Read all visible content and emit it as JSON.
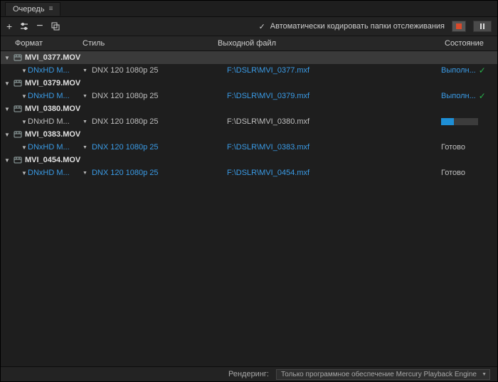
{
  "window": {
    "title": "Очередь"
  },
  "toolbar": {
    "add": "+",
    "auto_encode_label": "Автоматически кодировать папки отслеживания"
  },
  "columns": {
    "format": "Формат",
    "style": "Стиль",
    "output": "Выходной файл",
    "state": "Состояние"
  },
  "groups": [
    {
      "name": "MVI_0377.MOV",
      "selected": true,
      "job": {
        "format": "DNxHD M...",
        "style": "DNX 120 1080p 25",
        "output": "F:\\DSLR\\MVI_0377.mxf",
        "state_text": "Выполн...",
        "state_kind": "done",
        "link": true,
        "style_link": false
      }
    },
    {
      "name": "MVI_0379.MOV",
      "selected": false,
      "job": {
        "format": "DNxHD M...",
        "style": "DNX 120 1080p 25",
        "output": "F:\\DSLR\\MVI_0379.mxf",
        "state_text": "Выполн...",
        "state_kind": "done",
        "link": true,
        "style_link": false
      }
    },
    {
      "name": "MVI_0380.MOV",
      "selected": false,
      "job": {
        "format": "DNxHD M...",
        "style": "DNX 120 1080p 25",
        "output": "F:\\DSLR\\MVI_0380.mxf",
        "state_text": "",
        "state_kind": "progress",
        "progress": 35,
        "link": false,
        "style_link": false
      }
    },
    {
      "name": "MVI_0383.MOV",
      "selected": false,
      "job": {
        "format": "DNxHD M...",
        "style": "DNX 120 1080p 25",
        "output": "F:\\DSLR\\MVI_0383.mxf",
        "state_text": "Готово",
        "state_kind": "ready",
        "link": true,
        "style_link": true
      }
    },
    {
      "name": "MVI_0454.MOV",
      "selected": false,
      "job": {
        "format": "DNxHD M...",
        "style": "DNX 120 1080p 25",
        "output": "F:\\DSLR\\MVI_0454.mxf",
        "state_text": "Готово",
        "state_kind": "ready",
        "link": true,
        "style_link": true
      }
    }
  ],
  "statusbar": {
    "renderer_label": "Рендеринг:",
    "renderer_value": "Только программное обеспечение Mercury Playback Engine"
  }
}
